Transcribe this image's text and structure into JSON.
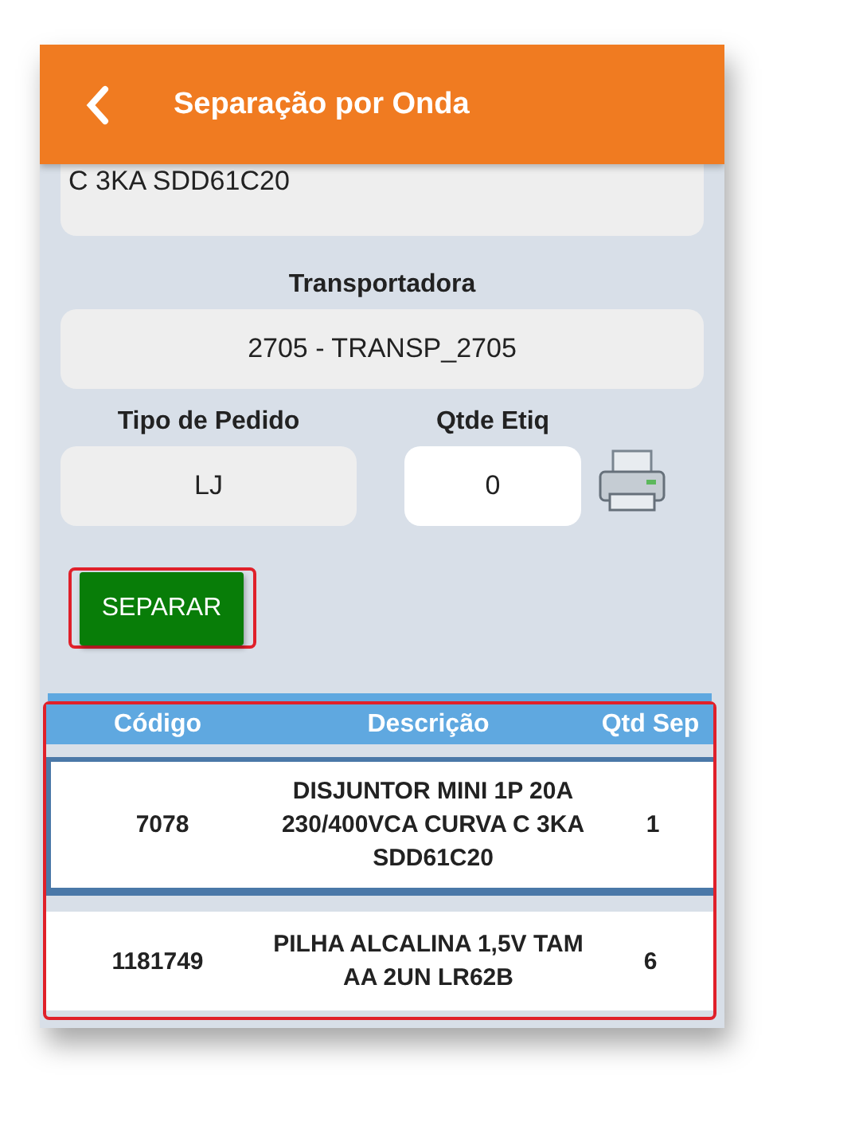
{
  "header": {
    "title": "Separação por Onda"
  },
  "description_field": {
    "value": "C 3KA SDD61C20"
  },
  "carrier": {
    "label": "Transportadora",
    "value": "2705 - TRANSP_2705"
  },
  "order_type": {
    "label": "Tipo de Pedido",
    "value": "LJ"
  },
  "label_qty": {
    "label": "Qtde Etiq",
    "value": "0"
  },
  "separate_button": {
    "label": "SEPARAR"
  },
  "table": {
    "columns": [
      "Código",
      "Descrição",
      "Qtd Sep"
    ],
    "rows": [
      {
        "code": "7078",
        "description": "DISJUNTOR MINI 1P 20A 230/400VCA CURVA C 3KA SDD61C20",
        "qty": "1",
        "selected": true
      },
      {
        "code": "1181749",
        "description": "PILHA ALCALINA 1,5V TAM AA 2UN LR62B",
        "qty": "6",
        "selected": false
      }
    ]
  }
}
